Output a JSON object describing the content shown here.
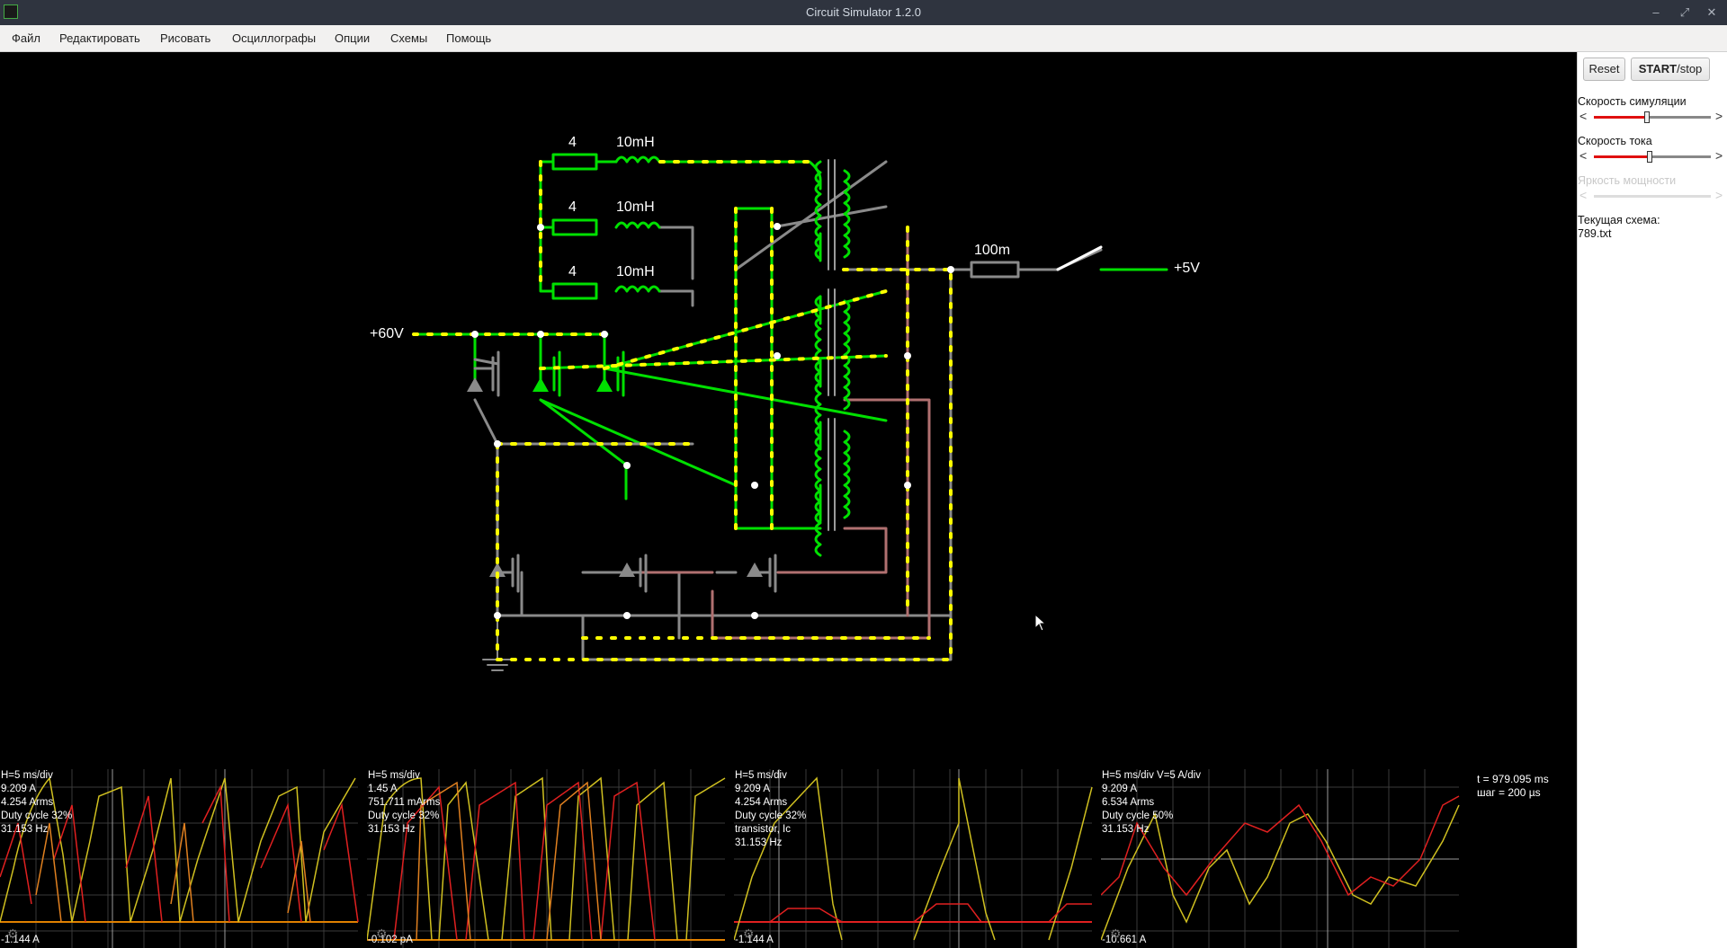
{
  "window": {
    "title": "Circuit Simulator 1.2.0",
    "controls": [
      "–",
      "⤢",
      "✕"
    ]
  },
  "menu": [
    "Файл",
    "Редактировать",
    "Рисовать",
    "Осциллографы",
    "Опции",
    "Схемы",
    "Помощь"
  ],
  "panel": {
    "reset": "Reset",
    "start_bold": "START",
    "start_rest": "/stop",
    "sim_speed_label": "Скорость симуляции",
    "sim_speed_value": 0.45,
    "current_speed_label": "Скорость тока",
    "current_speed_value": 0.48,
    "power_brightness_label": "Яркость мощности",
    "current_circuit_label": "Текущая схема:",
    "current_circuit_file": "789.txt"
  },
  "circuit_labels": {
    "r1": "4",
    "l1": "10mH",
    "r2": "4",
    "l2": "10mH",
    "r3": "4",
    "l3": "10mH",
    "vin": "+60V",
    "rout": "100m",
    "vout": "+5V"
  },
  "scopes": [
    {
      "lines": [
        "H=5 ms/div",
        "9.209 A",
        "4.254 Arms",
        "Duty cycle 32%",
        "31.153 Hz"
      ],
      "min": "-1.144 A"
    },
    {
      "lines": [
        "H=5 ms/div",
        "1.45 A",
        "751.711 mArms",
        "Duty cycle 32%",
        "31.153 Hz"
      ],
      "min": "-0.102 pA"
    },
    {
      "lines": [
        "H=5 ms/div",
        "9.209 A",
        "4.254 Arms",
        "Duty cycle 32%",
        "transistor, Ic",
        "31.153 Hz"
      ],
      "min": "-1.144 A"
    },
    {
      "lines": [
        "H=5 ms/div V=5 A/div",
        "9.209 A",
        "6.534 Arms",
        "Duty cycle 50%",
        "31.153 Hz"
      ],
      "min": "-10.661 A"
    }
  ],
  "sim_info": {
    "time": "t = 979.095 ms",
    "step": "шаг = 200 µs"
  },
  "colors": {
    "live": "#00e000",
    "dead": "#808080",
    "neg": "#b07070",
    "dot": "#ffff00",
    "sel": "#ffffff"
  }
}
